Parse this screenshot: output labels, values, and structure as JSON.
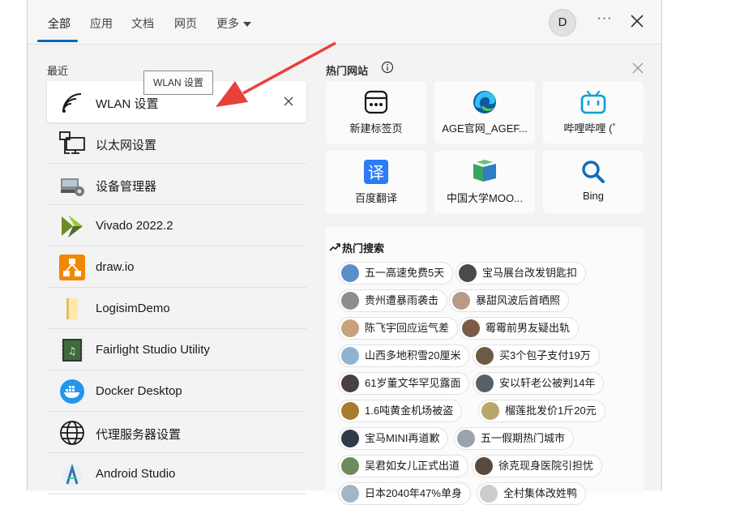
{
  "tabs": [
    {
      "label": "全部"
    },
    {
      "label": "应用"
    },
    {
      "label": "文档"
    },
    {
      "label": "网页"
    },
    {
      "label": "更多"
    }
  ],
  "user": {
    "initial": "D"
  },
  "recent": {
    "section_label": "最近",
    "tooltip": "WLAN 设置",
    "items": [
      {
        "label": "WLAN 设置",
        "icon": "wifi-icon"
      },
      {
        "label": "以太网设置",
        "icon": "ethernet-icon"
      },
      {
        "label": "设备管理器",
        "icon": "device-manager-icon"
      },
      {
        "label": "Vivado 2022.2",
        "icon": "vivado-icon"
      },
      {
        "label": "draw.io",
        "icon": "drawio-icon"
      },
      {
        "label": "LogisimDemo",
        "icon": "folder-icon"
      },
      {
        "label": "Fairlight Studio Utility",
        "icon": "fairlight-icon"
      },
      {
        "label": "Docker Desktop",
        "icon": "docker-icon"
      },
      {
        "label": "代理服务器设置",
        "icon": "globe-icon"
      },
      {
        "label": "Android Studio",
        "icon": "android-studio-icon"
      }
    ]
  },
  "hot_sites": {
    "section_label": "热门网站",
    "tiles": [
      {
        "label": "新建标签页",
        "icon": "new-tab-icon"
      },
      {
        "label": "AGE官网_AGEF...",
        "icon": "edge-icon"
      },
      {
        "label": "哔哩哔哩 (゜",
        "icon": "bilibili-icon"
      },
      {
        "label": "百度翻译",
        "icon": "baidu-translate-icon"
      },
      {
        "label": "中国大学MOO...",
        "icon": "mooc-icon"
      },
      {
        "label": "Bing",
        "icon": "bing-icon"
      }
    ]
  },
  "hot_search": {
    "title": "热门搜索",
    "items": [
      {
        "label": "五一高速免费5天",
        "color": "#5b8fc9"
      },
      {
        "label": "宝马展台改发钥匙扣",
        "color": "#4a4a4a"
      },
      {
        "label": "贵州遭暴雨袭击",
        "color": "#8d8d8d"
      },
      {
        "label": "暴甜风波后首晒照",
        "color": "#b89a88"
      },
      {
        "label": "陈飞宇回应运气差",
        "color": "#c7a27a"
      },
      {
        "label": "霉霉前男友疑出轨",
        "color": "#7a5a48"
      },
      {
        "label": "山西多地积雪20厘米",
        "color": "#8fb3cf"
      },
      {
        "label": "买3个包子支付19万",
        "color": "#6b5a45"
      },
      {
        "label": "61岁董文华罕见露面",
        "color": "#4a3f45"
      },
      {
        "label": "安以轩老公被判14年",
        "color": "#59606b"
      },
      {
        "label": "1.6吨黄金机场被盗",
        "color": "#a67c2e"
      },
      {
        "label": "榴莲批发价1斤20元",
        "color": "#b9a66a"
      },
      {
        "label": "宝马MINI再道歉",
        "color": "#2f3a48"
      },
      {
        "label": "五一假期热门城市",
        "color": "#9aa3ab"
      },
      {
        "label": "吴君如女儿正式出道",
        "color": "#6f8a5a"
      },
      {
        "label": "徐克现身医院引担忧",
        "color": "#5a4a3d"
      },
      {
        "label": "日本2040年47%单身",
        "color": "#a4b5c4"
      },
      {
        "label": "全村集体改姓鸭",
        "color": "#cccccc"
      }
    ]
  },
  "colors": {
    "accent": "#0067c0",
    "arrow": "#e8413a"
  }
}
